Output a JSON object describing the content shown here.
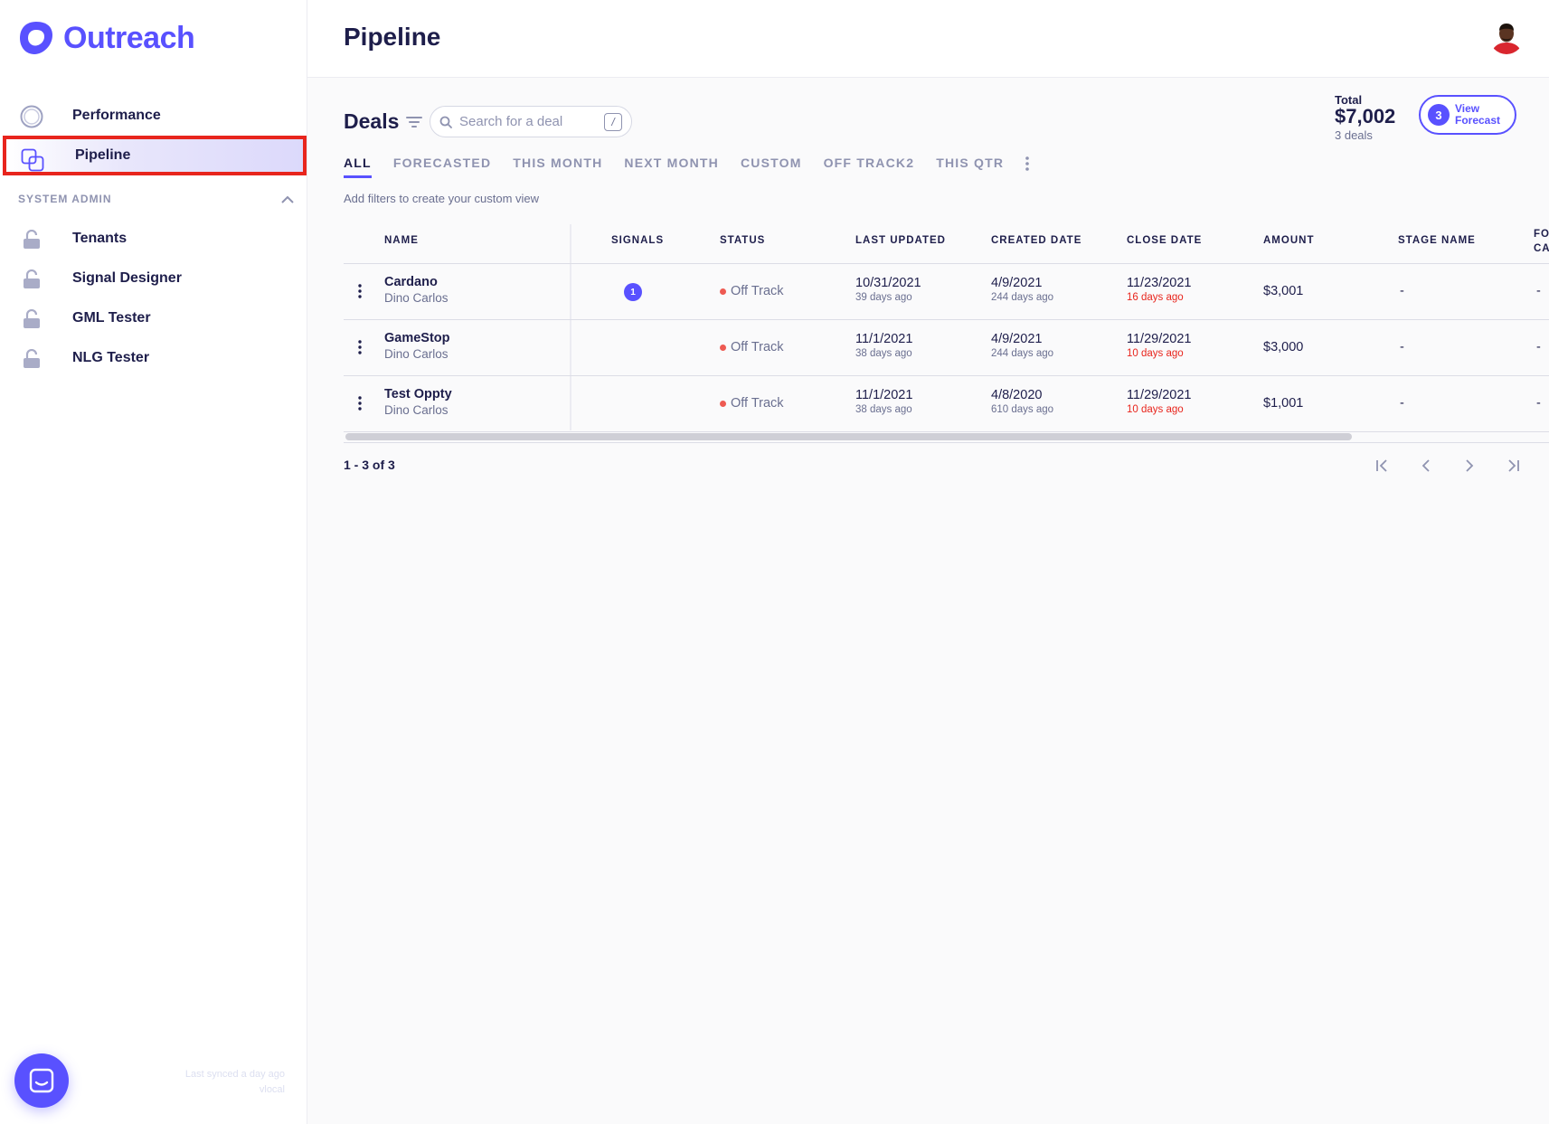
{
  "app": {
    "logo_text": "Outreach"
  },
  "sidebar": {
    "items": [
      {
        "label": "Performance"
      },
      {
        "label": "Pipeline"
      }
    ],
    "section_title": "SYSTEM ADMIN",
    "admin_items": [
      {
        "label": "Tenants"
      },
      {
        "label": "Signal Designer"
      },
      {
        "label": "GML Tester"
      },
      {
        "label": "NLG Tester"
      }
    ],
    "synced_line1": "Last synced a day ago",
    "synced_line2": "vlocal"
  },
  "header": {
    "title": "Pipeline"
  },
  "deals": {
    "title": "Deals",
    "search_placeholder": "Search for a deal",
    "search_shortcut": "/",
    "total_label": "Total",
    "total_value": "$7,002",
    "total_count": "3 deals",
    "forecast_badge": "3",
    "forecast_line1": "View",
    "forecast_line2": "Forecast",
    "tabs": [
      "ALL",
      "FORECASTED",
      "THIS MONTH",
      "NEXT MONTH",
      "CUSTOM",
      "OFF TRACK2",
      "THIS QTR"
    ],
    "hint": "Add filters to create your custom view"
  },
  "table": {
    "columns": [
      "NAME",
      "SIGNALS",
      "STATUS",
      "LAST UPDATED",
      "CREATED DATE",
      "CLOSE DATE",
      "AMOUNT",
      "STAGE NAME",
      "FO",
      "CA"
    ],
    "rows": [
      {
        "name": "Cardano",
        "owner": "Dino Carlos",
        "signals": "1",
        "status": "Off Track",
        "last_updated": "10/31/2021",
        "last_updated_ago": "39 days ago",
        "created": "4/9/2021",
        "created_ago": "244 days ago",
        "close": "11/23/2021",
        "close_ago": "16 days ago",
        "amount": "$3,001",
        "stage": "-",
        "fo": "-"
      },
      {
        "name": "GameStop",
        "owner": "Dino Carlos",
        "signals": "",
        "status": "Off Track",
        "last_updated": "11/1/2021",
        "last_updated_ago": "38 days ago",
        "created": "4/9/2021",
        "created_ago": "244 days ago",
        "close": "11/29/2021",
        "close_ago": "10 days ago",
        "amount": "$3,000",
        "stage": "-",
        "fo": "-"
      },
      {
        "name": "Test Oppty",
        "owner": "Dino Carlos",
        "signals": "",
        "status": "Off Track",
        "last_updated": "11/1/2021",
        "last_updated_ago": "38 days ago",
        "created": "4/8/2020",
        "created_ago": "610 days ago",
        "close": "11/29/2021",
        "close_ago": "10 days ago",
        "amount": "$1,001",
        "stage": "-",
        "fo": "-"
      }
    ]
  },
  "pagination": {
    "text": "1 - 3 of 3"
  },
  "colors": {
    "accent": "#5951ff",
    "highlight_border": "#e8251d",
    "status_dot": "#ee5a52",
    "overdue": "#e8251d"
  }
}
